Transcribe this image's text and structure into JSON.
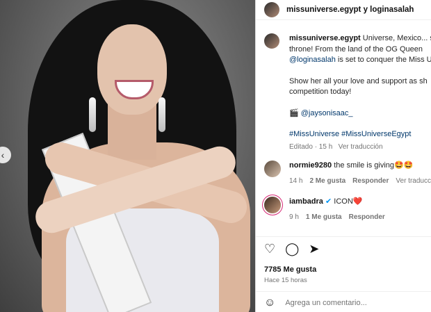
{
  "post": {
    "carousel_prev": "‹"
  },
  "header": {
    "title": "missuniverse.egypt y loginasalah"
  },
  "caption": {
    "username": "missuniverse.egypt",
    "line1": " Universe, Mexico... sh",
    "line2": "throne! From the land of the OG Queen",
    "line3_mention": "@loginasalah",
    "line3_rest": " is set to conquer the Miss U",
    "line4": "Show her all your love and support as sh",
    "line5": "competition today!",
    "camera_emoji": "🎬",
    "photographer": "@jaysonisaac_",
    "hashtags": "#MissUniverse #MissUniverseEgypt",
    "edited": "Editado · 15 h",
    "see_translation": "Ver traducción"
  },
  "comments": [
    {
      "username": "normie9280",
      "text": "the smile is giving🤩🤩",
      "time": "14 h",
      "likes": "2 Me gusta",
      "reply": "Responder",
      "translate": "Ver traducción"
    },
    {
      "username": "iambadra",
      "verified": "✔",
      "text": "ICON❤️",
      "time": "9 h",
      "likes": "1 Me gusta",
      "reply": "Responder"
    }
  ],
  "actions": {
    "like_icon": "♡",
    "comment_icon": "◯",
    "share_icon": "➤",
    "likes_count": "7785 Me gusta",
    "time_ago": "Hace 15 horas",
    "emoji_icon": "☺",
    "comment_placeholder": "Agrega un comentario..."
  }
}
